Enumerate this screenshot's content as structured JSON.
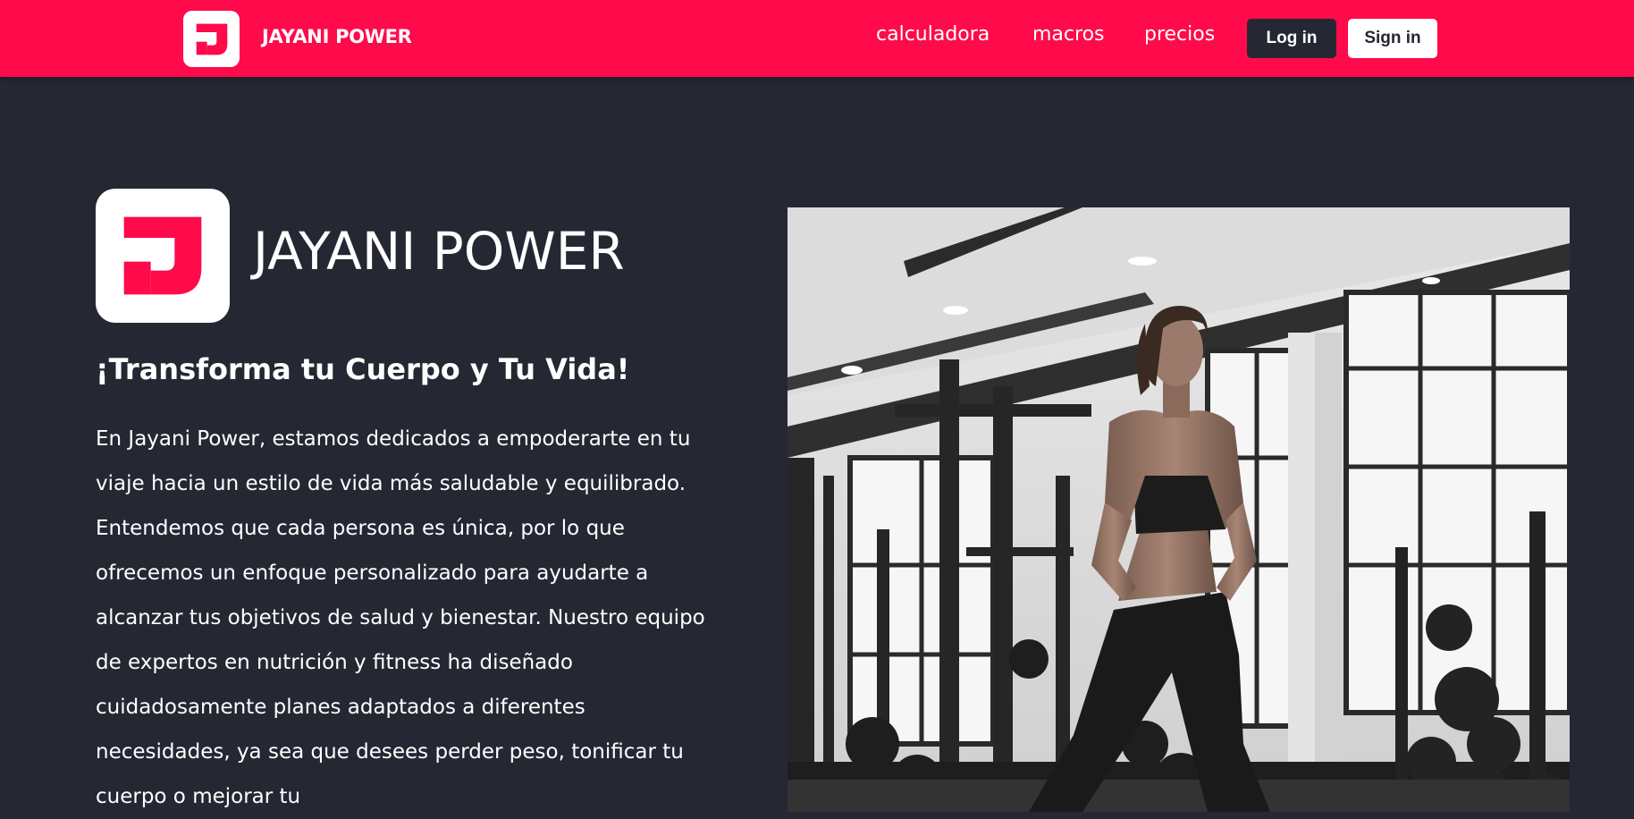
{
  "navbar": {
    "brand": "JAYANI POWER",
    "logo_icon": "jayani-j-logo-icon",
    "links": [
      {
        "label": "calculadora"
      },
      {
        "label": "macros"
      },
      {
        "label": "precios"
      }
    ],
    "login_label": "Log in",
    "signin_label": "Sign in"
  },
  "hero": {
    "brand": "JAYANI POWER",
    "tagline": "¡Transforma tu Cuerpo y Tu Vida!",
    "description": "En Jayani Power, estamos dedicados a empoderarte en tu viaje hacia un estilo de vida más saludable y equilibrado. Entendemos que cada persona es única, por lo que ofrecemos un enfoque personalizado para ayudarte a alcanzar tus objetivos de salud y bienestar. Nuestro equipo de expertos en nutrición y fitness ha diseñado cuidadosamente planes adaptados a diferentes necesidades, ya sea que desees perder peso, tonificar tu cuerpo o mejorar tu",
    "image": "woman-in-gym-photo"
  },
  "colors": {
    "brand_pink": "#ff0a4a",
    "dark_bg": "#252833",
    "white": "#ffffff"
  }
}
